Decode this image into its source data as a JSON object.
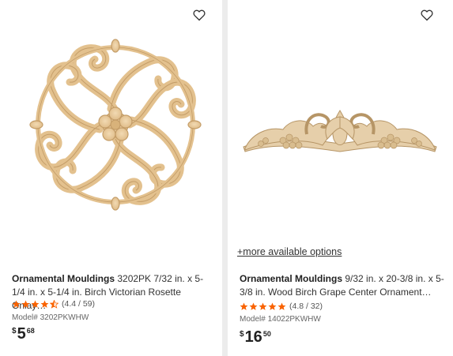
{
  "products": [
    {
      "brand": "Ornamental Mouldings",
      "title_rest": " 3202PK 7/32 in. x 5-1/4 in. x 5-1/4 in. Birch Victorian Rosette Onlay…",
      "rating_stars": 4.4,
      "rating_text": "(4.4 / 59)",
      "model": "Model# 3202PKWHW",
      "price_currency": "$",
      "price_dollars": "5",
      "price_cents": "68",
      "image_icon": "rosette-onlay-image"
    },
    {
      "more_options": "+more available options",
      "brand": "Ornamental Mouldings",
      "title_rest": " 9/32 in. x 20-3/8 in. x 5-3/8 in. Wood Birch Grape Center Ornament…",
      "rating_stars": 4.8,
      "rating_text": "(4.8 / 32)",
      "model": "Model# 14022PKWHW",
      "price_currency": "$",
      "price_dollars": "16",
      "price_cents": "50",
      "image_icon": "grape-center-ornament-image"
    }
  ],
  "colors": {
    "star": "#f96302",
    "wood": "#e8c99a",
    "wood_shade": "#c9a672"
  }
}
